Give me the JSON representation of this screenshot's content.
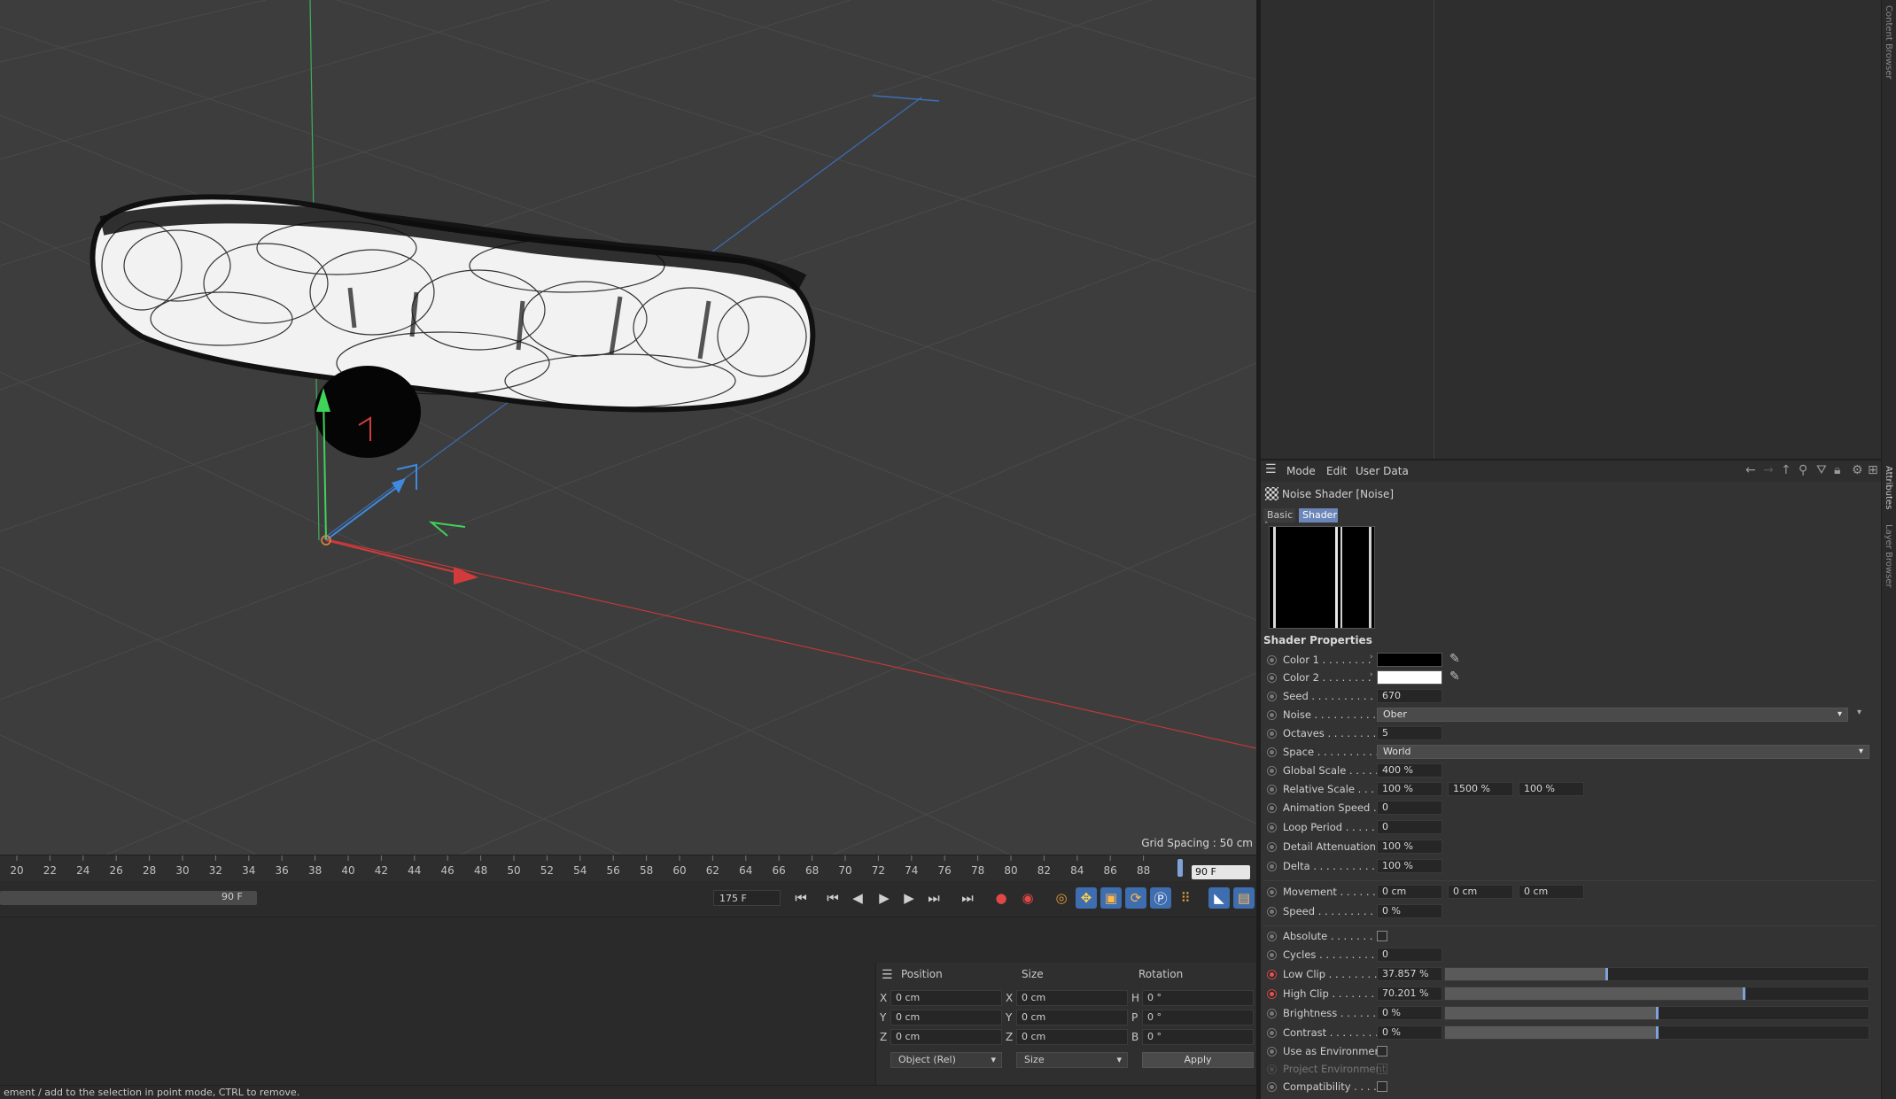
{
  "viewport": {
    "grid_spacing": "Grid Spacing : 50 cm"
  },
  "timeline": {
    "ticks": [
      "20",
      "22",
      "24",
      "26",
      "28",
      "30",
      "32",
      "34",
      "36",
      "38",
      "40",
      "42",
      "44",
      "46",
      "48",
      "50",
      "52",
      "54",
      "56",
      "58",
      "60",
      "62",
      "64",
      "66",
      "68",
      "70",
      "72",
      "74",
      "76",
      "78",
      "80",
      "82",
      "84",
      "86",
      "88"
    ],
    "current_frame": "90 F",
    "range_end_label": "90 F",
    "end_frame": "175 F"
  },
  "coordinates": {
    "headers": {
      "position": "Position",
      "size": "Size",
      "rotation": "Rotation"
    },
    "rows": [
      {
        "axis": "X",
        "pos": "0 cm",
        "size_axis": "X",
        "size": "0 cm",
        "rot_axis": "H",
        "rot": "0 °"
      },
      {
        "axis": "Y",
        "pos": "0 cm",
        "size_axis": "Y",
        "size": "0 cm",
        "rot_axis": "P",
        "rot": "0 °"
      },
      {
        "axis": "Z",
        "pos": "0 cm",
        "size_axis": "Z",
        "size": "0 cm",
        "rot_axis": "B",
        "rot": "0 °"
      }
    ],
    "mode_select": "Object (Rel)",
    "size_select": "Size",
    "apply": "Apply"
  },
  "status": {
    "text": "ement / add to the selection in point mode, CTRL to remove."
  },
  "side_tabs": {
    "top": "Content Browser",
    "attributes": "Attributes",
    "layers": "Layer Browser"
  },
  "attributes": {
    "menu": [
      "Mode",
      "Edit",
      "User Data"
    ],
    "object_title": "Noise Shader [Noise]",
    "tabs": [
      "Basic",
      "Shader"
    ],
    "section": "Shader Properties",
    "color1_label": "Color 1 . . . . . . . .",
    "color2_label": "Color 2 . . . . . . . .",
    "seed_label": "Seed . . . . . . . . . .",
    "seed": "670",
    "noise_label": "Noise . . . . . . . . . .",
    "noise": "Ober",
    "octaves_label": "Octaves . . . . . . . .",
    "octaves": "5",
    "space_label": "Space . . . . . . . . . .",
    "space": "World",
    "global_scale_label": "Global Scale . . . . .",
    "global_scale": "400 %",
    "relative_scale_label": "Relative Scale . . . .",
    "relative_scale": [
      "100 %",
      "1500 %",
      "100 %"
    ],
    "anim_speed_label": "Animation Speed . .",
    "anim_speed": "0",
    "loop_period_label": "Loop Period . . . . .",
    "loop_period": "0",
    "detail_att_label": "Detail Attenuation",
    "detail_att": "100 %",
    "delta_label": "Delta . . . . . . . . . .",
    "delta": "100 %",
    "movement_label": "Movement . . . . . . .",
    "movement": [
      "0 cm",
      "0 cm",
      "0 cm"
    ],
    "speed_label": "Speed . . . . . . . . . .",
    "speed": "0 %",
    "absolute_label": "Absolute . . . . . . . .",
    "cycles_label": "Cycles . . . . . . . . . .",
    "cycles": "0",
    "low_clip_label": "Low Clip . . . . . . . .",
    "low_clip": "37.857 %",
    "low_clip_value": 37.857,
    "high_clip_label": "High Clip . . . . . . .",
    "high_clip": "70.201 %",
    "high_clip_value": 70.201,
    "brightness_label": "Brightness . . . . . .",
    "brightness": "0 %",
    "contrast_label": "Contrast . . . . . . . .",
    "contrast": "0 %",
    "use_env_label": "Use as Environment",
    "project_env_label": "Project Environment",
    "compat_label": "Compatibility . . . ."
  }
}
